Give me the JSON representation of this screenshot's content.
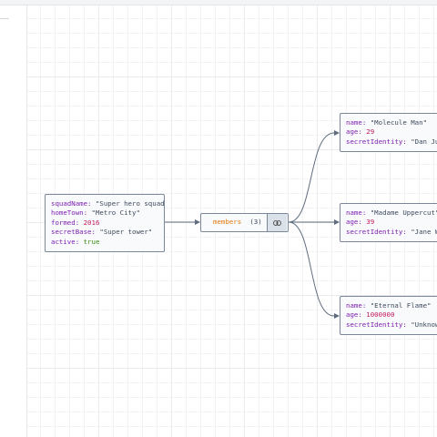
{
  "root": {
    "fields": [
      {
        "key": "squadName",
        "value": "\"Super hero squad\"",
        "kind": "str"
      },
      {
        "key": "homeTown",
        "value": "\"Metro City\"",
        "kind": "str"
      },
      {
        "key": "formed",
        "value": "2016",
        "kind": "num"
      },
      {
        "key": "secretBase",
        "value": "\"Super tower\"",
        "kind": "str"
      },
      {
        "key": "active",
        "value": "true",
        "kind": "bool"
      }
    ]
  },
  "members": {
    "label": "members",
    "count": "(3)",
    "collapse_icon": "link-icon"
  },
  "member_nodes": [
    {
      "fields": [
        {
          "key": "name",
          "value": "\"Molecule Man\"",
          "kind": "str"
        },
        {
          "key": "age",
          "value": "29",
          "kind": "num"
        },
        {
          "key": "secretIdentity",
          "value": "\"Dan Jukes\"",
          "kind": "str"
        }
      ]
    },
    {
      "fields": [
        {
          "key": "name",
          "value": "\"Madame Uppercut\"",
          "kind": "str"
        },
        {
          "key": "age",
          "value": "39",
          "kind": "num"
        },
        {
          "key": "secretIdentity",
          "value": "\"Jane Wilson\"",
          "kind": "str"
        }
      ]
    },
    {
      "fields": [
        {
          "key": "name",
          "value": "\"Eternal Flame\"",
          "kind": "str"
        },
        {
          "key": "age",
          "value": "1000000",
          "kind": "num"
        },
        {
          "key": "secretIdentity",
          "value": "\"Unknown\"",
          "kind": "str"
        }
      ]
    }
  ]
}
